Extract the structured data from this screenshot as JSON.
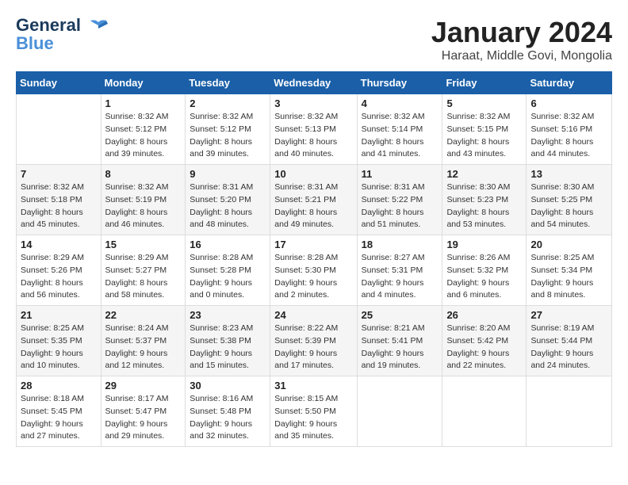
{
  "header": {
    "logo_line1": "General",
    "logo_line2": "Blue",
    "title": "January 2024",
    "subtitle": "Haraat, Middle Govi, Mongolia"
  },
  "weekdays": [
    "Sunday",
    "Monday",
    "Tuesday",
    "Wednesday",
    "Thursday",
    "Friday",
    "Saturday"
  ],
  "weeks": [
    [
      {
        "day": "",
        "sunrise": "",
        "sunset": "",
        "daylight": ""
      },
      {
        "day": "1",
        "sunrise": "Sunrise: 8:32 AM",
        "sunset": "Sunset: 5:12 PM",
        "daylight": "Daylight: 8 hours and 39 minutes."
      },
      {
        "day": "2",
        "sunrise": "Sunrise: 8:32 AM",
        "sunset": "Sunset: 5:12 PM",
        "daylight": "Daylight: 8 hours and 39 minutes."
      },
      {
        "day": "3",
        "sunrise": "Sunrise: 8:32 AM",
        "sunset": "Sunset: 5:13 PM",
        "daylight": "Daylight: 8 hours and 40 minutes."
      },
      {
        "day": "4",
        "sunrise": "Sunrise: 8:32 AM",
        "sunset": "Sunset: 5:14 PM",
        "daylight": "Daylight: 8 hours and 41 minutes."
      },
      {
        "day": "5",
        "sunrise": "Sunrise: 8:32 AM",
        "sunset": "Sunset: 5:15 PM",
        "daylight": "Daylight: 8 hours and 43 minutes."
      },
      {
        "day": "6",
        "sunrise": "Sunrise: 8:32 AM",
        "sunset": "Sunset: 5:16 PM",
        "daylight": "Daylight: 8 hours and 44 minutes."
      }
    ],
    [
      {
        "day": "7",
        "sunrise": "Sunrise: 8:32 AM",
        "sunset": "Sunset: 5:18 PM",
        "daylight": "Daylight: 8 hours and 45 minutes."
      },
      {
        "day": "8",
        "sunrise": "Sunrise: 8:32 AM",
        "sunset": "Sunset: 5:19 PM",
        "daylight": "Daylight: 8 hours and 46 minutes."
      },
      {
        "day": "9",
        "sunrise": "Sunrise: 8:31 AM",
        "sunset": "Sunset: 5:20 PM",
        "daylight": "Daylight: 8 hours and 48 minutes."
      },
      {
        "day": "10",
        "sunrise": "Sunrise: 8:31 AM",
        "sunset": "Sunset: 5:21 PM",
        "daylight": "Daylight: 8 hours and 49 minutes."
      },
      {
        "day": "11",
        "sunrise": "Sunrise: 8:31 AM",
        "sunset": "Sunset: 5:22 PM",
        "daylight": "Daylight: 8 hours and 51 minutes."
      },
      {
        "day": "12",
        "sunrise": "Sunrise: 8:30 AM",
        "sunset": "Sunset: 5:23 PM",
        "daylight": "Daylight: 8 hours and 53 minutes."
      },
      {
        "day": "13",
        "sunrise": "Sunrise: 8:30 AM",
        "sunset": "Sunset: 5:25 PM",
        "daylight": "Daylight: 8 hours and 54 minutes."
      }
    ],
    [
      {
        "day": "14",
        "sunrise": "Sunrise: 8:29 AM",
        "sunset": "Sunset: 5:26 PM",
        "daylight": "Daylight: 8 hours and 56 minutes."
      },
      {
        "day": "15",
        "sunrise": "Sunrise: 8:29 AM",
        "sunset": "Sunset: 5:27 PM",
        "daylight": "Daylight: 8 hours and 58 minutes."
      },
      {
        "day": "16",
        "sunrise": "Sunrise: 8:28 AM",
        "sunset": "Sunset: 5:28 PM",
        "daylight": "Daylight: 9 hours and 0 minutes."
      },
      {
        "day": "17",
        "sunrise": "Sunrise: 8:28 AM",
        "sunset": "Sunset: 5:30 PM",
        "daylight": "Daylight: 9 hours and 2 minutes."
      },
      {
        "day": "18",
        "sunrise": "Sunrise: 8:27 AM",
        "sunset": "Sunset: 5:31 PM",
        "daylight": "Daylight: 9 hours and 4 minutes."
      },
      {
        "day": "19",
        "sunrise": "Sunrise: 8:26 AM",
        "sunset": "Sunset: 5:32 PM",
        "daylight": "Daylight: 9 hours and 6 minutes."
      },
      {
        "day": "20",
        "sunrise": "Sunrise: 8:25 AM",
        "sunset": "Sunset: 5:34 PM",
        "daylight": "Daylight: 9 hours and 8 minutes."
      }
    ],
    [
      {
        "day": "21",
        "sunrise": "Sunrise: 8:25 AM",
        "sunset": "Sunset: 5:35 PM",
        "daylight": "Daylight: 9 hours and 10 minutes."
      },
      {
        "day": "22",
        "sunrise": "Sunrise: 8:24 AM",
        "sunset": "Sunset: 5:37 PM",
        "daylight": "Daylight: 9 hours and 12 minutes."
      },
      {
        "day": "23",
        "sunrise": "Sunrise: 8:23 AM",
        "sunset": "Sunset: 5:38 PM",
        "daylight": "Daylight: 9 hours and 15 minutes."
      },
      {
        "day": "24",
        "sunrise": "Sunrise: 8:22 AM",
        "sunset": "Sunset: 5:39 PM",
        "daylight": "Daylight: 9 hours and 17 minutes."
      },
      {
        "day": "25",
        "sunrise": "Sunrise: 8:21 AM",
        "sunset": "Sunset: 5:41 PM",
        "daylight": "Daylight: 9 hours and 19 minutes."
      },
      {
        "day": "26",
        "sunrise": "Sunrise: 8:20 AM",
        "sunset": "Sunset: 5:42 PM",
        "daylight": "Daylight: 9 hours and 22 minutes."
      },
      {
        "day": "27",
        "sunrise": "Sunrise: 8:19 AM",
        "sunset": "Sunset: 5:44 PM",
        "daylight": "Daylight: 9 hours and 24 minutes."
      }
    ],
    [
      {
        "day": "28",
        "sunrise": "Sunrise: 8:18 AM",
        "sunset": "Sunset: 5:45 PM",
        "daylight": "Daylight: 9 hours and 27 minutes."
      },
      {
        "day": "29",
        "sunrise": "Sunrise: 8:17 AM",
        "sunset": "Sunset: 5:47 PM",
        "daylight": "Daylight: 9 hours and 29 minutes."
      },
      {
        "day": "30",
        "sunrise": "Sunrise: 8:16 AM",
        "sunset": "Sunset: 5:48 PM",
        "daylight": "Daylight: 9 hours and 32 minutes."
      },
      {
        "day": "31",
        "sunrise": "Sunrise: 8:15 AM",
        "sunset": "Sunset: 5:50 PM",
        "daylight": "Daylight: 9 hours and 35 minutes."
      },
      {
        "day": "",
        "sunrise": "",
        "sunset": "",
        "daylight": ""
      },
      {
        "day": "",
        "sunrise": "",
        "sunset": "",
        "daylight": ""
      },
      {
        "day": "",
        "sunrise": "",
        "sunset": "",
        "daylight": ""
      }
    ]
  ]
}
